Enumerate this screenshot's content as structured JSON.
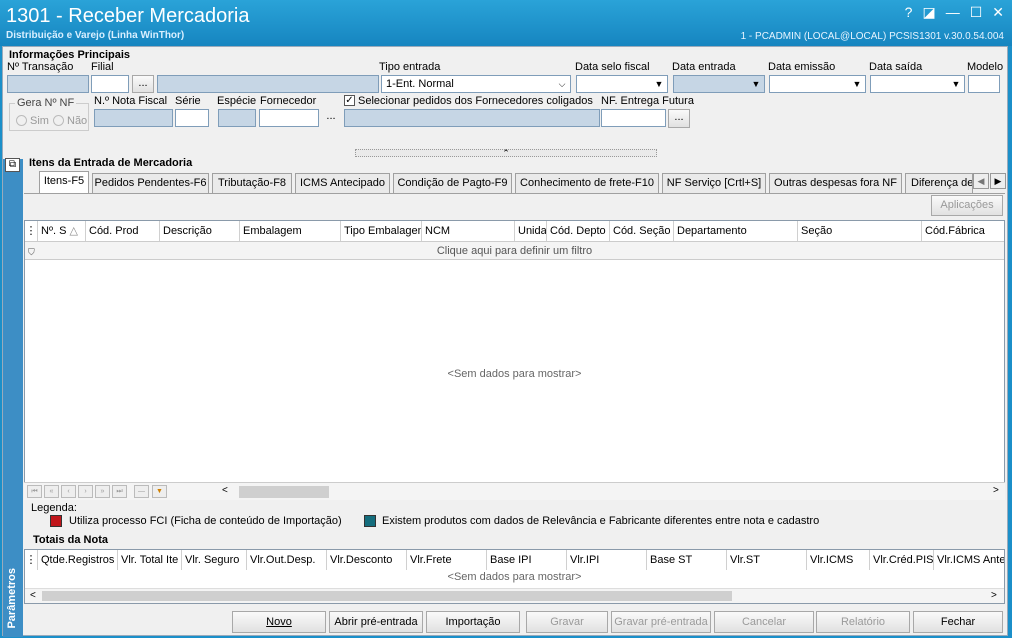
{
  "window": {
    "title": "1301 - Receber Mercadoria",
    "subtitle": "Distribuição e Varejo (Linha WinThor)",
    "user_info": "1 - PCADMIN (LOCAL@LOCAL)   PCSIS1301  v.30.0.54.004",
    "controls": [
      "?",
      "◪",
      "—",
      "☐",
      "✕"
    ]
  },
  "info": {
    "section_title": "Informações Principais",
    "transacao_label": "Nº Transação",
    "filial_label": "Filial",
    "filial_btn": "...",
    "tipo_entrada_label": "Tipo entrada",
    "tipo_entrada_value": "1-Ent. Normal",
    "data_selo_label": "Data selo fiscal",
    "data_entrada_label": "Data entrada",
    "data_emissao_label": "Data emissão",
    "data_saida_label": "Data saída",
    "modelo_label": "Modelo",
    "gera_nf_label": "Gera Nº NF",
    "sim_label": "Sim",
    "nao_label": "Não",
    "nota_fiscal_label": "N.º Nota Fiscal",
    "serie_label": "Série",
    "especie_label": "Espécie",
    "fornecedor_label": "Fornecedor",
    "fornecedor_btn": "...",
    "selecionar_pedidos_label": "Selecionar pedidos dos Fornecedores coligados",
    "nf_entrega_futura_label": "NF. Entrega Futura",
    "nf_entrega_btn": "..."
  },
  "itens": {
    "section_title": "Itens da Entrada de Mercadoria",
    "tabs": [
      "Itens-F5",
      "Pedidos Pendentes-F6",
      "Tributação-F8",
      "ICMS Antecipado",
      "Condição de Pagto-F9",
      "Conhecimento de frete-F10",
      "NF Serviço [Crtl+S]",
      "Outras despesas fora NF",
      "Diferença de"
    ],
    "aplicacoes_button": "Aplicações",
    "columns": [
      "Nº. S",
      "Cód. Prod",
      "Descrição",
      "Embalagem",
      "Tipo Embalagem",
      "NCM",
      "Unida",
      "Cód. Depto",
      "Cód. Seção",
      "Departamento",
      "Seção",
      "Cód.Fábrica"
    ],
    "filter_text": "Clique aqui para definir um filtro",
    "no_data": "<Sem dados para mostrar>"
  },
  "legend": {
    "title": "Legenda:",
    "items": [
      {
        "color": "#c0161b",
        "text": "Utiliza processo FCI (Ficha de conteúdo de Importação)"
      },
      {
        "color": "#146d7d",
        "text": "Existem produtos com dados de Relevância e Fabricante diferentes entre nota e cadastro"
      }
    ]
  },
  "totais": {
    "section_title": "Totais da Nota",
    "columns": [
      "Qtde.Registros",
      "Vlr. Total Ite",
      "Vlr. Seguro",
      "Vlr.Out.Desp.",
      "Vlr.Desconto",
      "Vlr.Frete",
      "Base IPI",
      "Vlr.IPI",
      "Base ST",
      "Vlr.ST",
      "Vlr.ICMS",
      "Vlr.Créd.PIS",
      "Vlr.ICMS Ante"
    ],
    "no_data": "<Sem dados para mostrar>"
  },
  "sidebar": {
    "label": "Parâmetros"
  },
  "buttons": {
    "novo": "Novo",
    "abrir": "Abrir pré-entrada",
    "importacao": "Importação",
    "gravar": "Gravar",
    "gravar_pre": "Gravar pré-entrada",
    "cancelar": "Cancelar",
    "relatorio": "Relatório",
    "fechar": "Fechar"
  }
}
